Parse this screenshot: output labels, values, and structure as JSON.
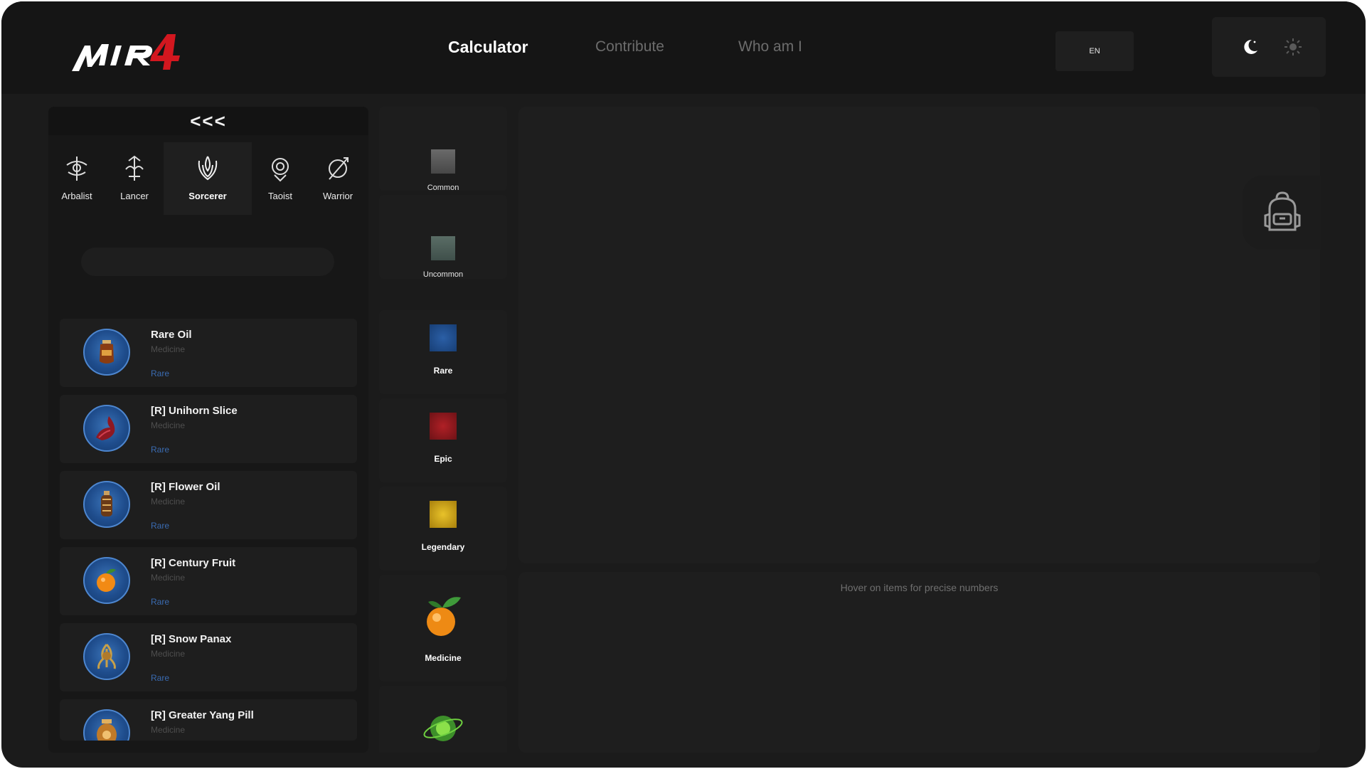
{
  "header": {
    "logo_text": "MIR4",
    "nav": [
      {
        "label": "Calculator",
        "active": true
      },
      {
        "label": "Contribute",
        "active": false
      },
      {
        "label": "Who am I",
        "active": false
      }
    ],
    "language": "EN",
    "theme_icons": [
      "moon-icon",
      "sun-icon"
    ]
  },
  "sidebar": {
    "collapse_label": "<<<",
    "classes": [
      {
        "label": "Arbalist",
        "icon": "arbalist-emblem-icon",
        "selected": false
      },
      {
        "label": "Lancer",
        "icon": "lancer-emblem-icon",
        "selected": false
      },
      {
        "label": "Sorcerer",
        "icon": "sorcerer-emblem-icon",
        "selected": true
      },
      {
        "label": "Taoist",
        "icon": "taoist-emblem-icon",
        "selected": false
      },
      {
        "label": "Warrior",
        "icon": "warrior-emblem-icon",
        "selected": false
      }
    ],
    "search": {
      "value": "",
      "placeholder": ""
    },
    "items": [
      {
        "name": "Rare Oil",
        "type": "Medicine",
        "rarity": "Rare",
        "icon": "oil-bottle-icon"
      },
      {
        "name": "[R] Unihorn Slice",
        "type": "Medicine",
        "rarity": "Rare",
        "icon": "horn-slice-icon"
      },
      {
        "name": "[R] Flower Oil",
        "type": "Medicine",
        "rarity": "Rare",
        "icon": "flower-oil-icon"
      },
      {
        "name": "[R] Century Fruit",
        "type": "Medicine",
        "rarity": "Rare",
        "icon": "fruit-icon"
      },
      {
        "name": "[R] Snow Panax",
        "type": "Medicine",
        "rarity": "Rare",
        "icon": "panax-root-icon"
      },
      {
        "name": "[R] Greater Yang Pill",
        "type": "Medicine",
        "rarity": "",
        "icon": "pill-jar-icon"
      }
    ]
  },
  "filters": {
    "rarities": [
      {
        "label": "Common",
        "color": "#5a5a5a"
      },
      {
        "label": "Uncommon",
        "color": "#4d5f59"
      },
      {
        "label": "Rare",
        "color": "#1e4c8c"
      },
      {
        "label": "Epic",
        "color": "#8c1a1f"
      },
      {
        "label": "Legendary",
        "color": "#c9a21a"
      }
    ],
    "categories": [
      {
        "label": "Medicine",
        "icon": "orange-fruit-icon"
      },
      {
        "label": "",
        "icon": "green-orb-icon"
      }
    ]
  },
  "main": {
    "inventory_icon": "backpack-icon",
    "hint": "Hover on items for precise numbers"
  }
}
